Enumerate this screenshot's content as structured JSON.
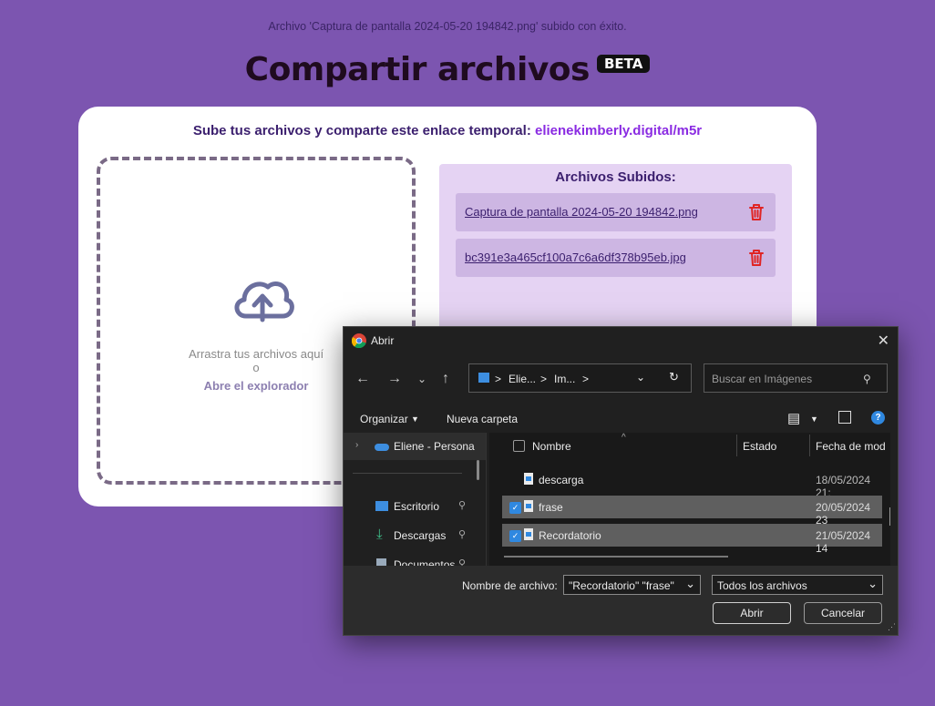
{
  "status_message": "Archivo 'Captura de pantalla 2024-05-20 194842.png' subido con éxito.",
  "page_title": "Compartir archivos",
  "beta_badge": "BETA",
  "share": {
    "prefix": "Sube tus archivos y comparte este enlace temporal:",
    "link": "elienekimberly.digital/m5r"
  },
  "dropzone": {
    "text": "Arrastra tus archivos aquí",
    "or": "o",
    "browse": "Abre el explorador"
  },
  "uploaded": {
    "title": "Archivos Subidos:",
    "files": [
      "Captura de pantalla 2024-05-20 194842.png",
      "bc391e3a465cf100a7c6a6df378b95eb.jpg"
    ]
  },
  "dialog": {
    "title": "Abrir",
    "address": [
      "Elie...",
      ">",
      "Im...",
      ">"
    ],
    "search_placeholder": "Buscar en Imágenes",
    "toolbar": {
      "organize": "Organizar",
      "new_folder": "Nueva carpeta"
    },
    "nav_items": [
      "Eliene - Persona",
      "Escritorio",
      "Descargas",
      "Documentos"
    ],
    "columns": [
      "Nombre",
      "Estado",
      "Fecha de mod"
    ],
    "rows": [
      {
        "name": "descarga",
        "date": "18/05/2024 21:",
        "selected": false
      },
      {
        "name": "frase",
        "date": "20/05/2024 23",
        "selected": true
      },
      {
        "name": "Recordatorio",
        "date": "21/05/2024 14",
        "selected": true
      }
    ],
    "filename_label": "Nombre de archivo:",
    "filename_value": "\"Recordatorio\" \"frase\"",
    "filter_value": "Todos los archivos",
    "open_button": "Abrir",
    "cancel_button": "Cancelar"
  }
}
